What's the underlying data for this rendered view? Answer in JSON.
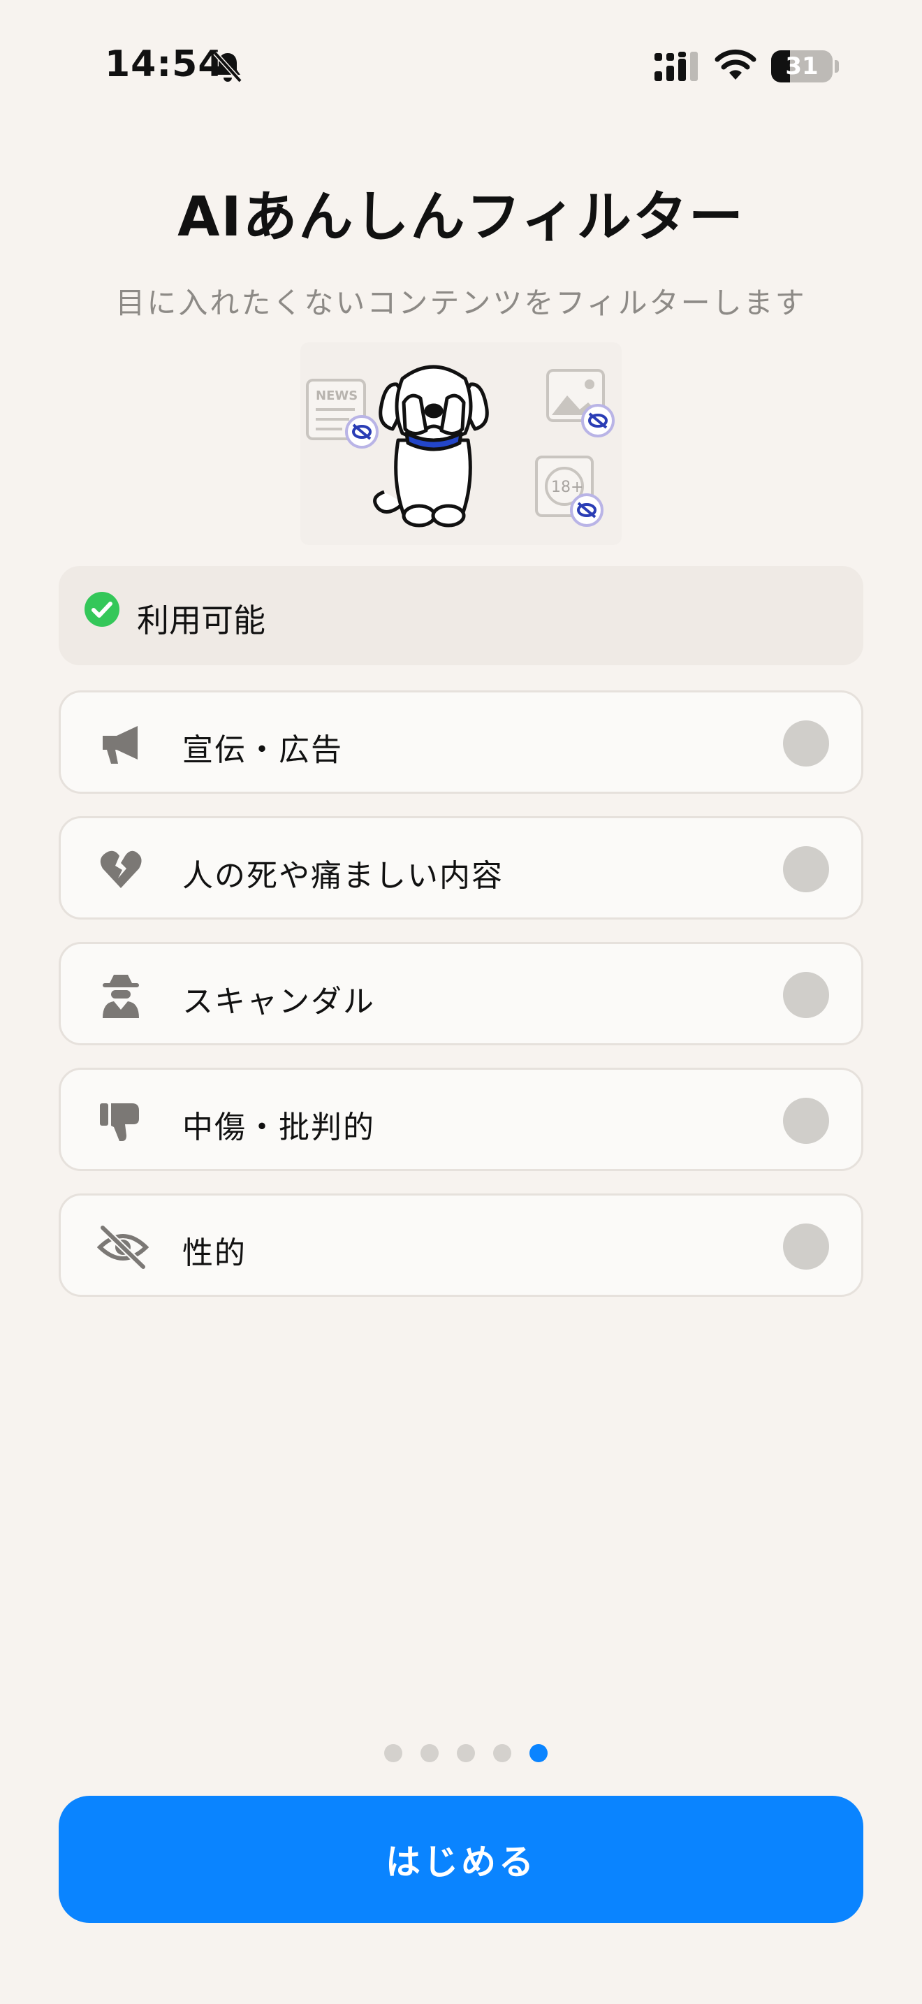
{
  "status_bar": {
    "time": "14:54",
    "battery_percent": "31",
    "battery_level": 0.31,
    "icons": [
      "bell-slash-icon",
      "cellular-signal-icon",
      "wifi-icon",
      "battery-icon"
    ]
  },
  "header": {
    "title": "AIあんしんフィルター",
    "subtitle": "目に入れたくないコンテンツをフィルターします"
  },
  "illustration": {
    "news_label": "NEWS",
    "age_label": "18+"
  },
  "availability": {
    "label": "利用可能",
    "icon": "check-circle-icon",
    "color": "#34c759"
  },
  "filters": [
    {
      "label": "宣伝・広告",
      "icon": "megaphone-icon",
      "enabled": false
    },
    {
      "label": "人の死や痛ましい内容",
      "icon": "broken-heart-icon",
      "enabled": false
    },
    {
      "label": "スキャンダル",
      "icon": "spy-icon",
      "enabled": false
    },
    {
      "label": "中傷・批判的",
      "icon": "thumbs-down-icon",
      "enabled": false
    },
    {
      "label": "性的",
      "icon": "eye-slash-icon",
      "enabled": false
    }
  ],
  "pagination": {
    "total": 5,
    "current": 5
  },
  "footer": {
    "start_label": "はじめる",
    "accent": "#0a84ff"
  }
}
